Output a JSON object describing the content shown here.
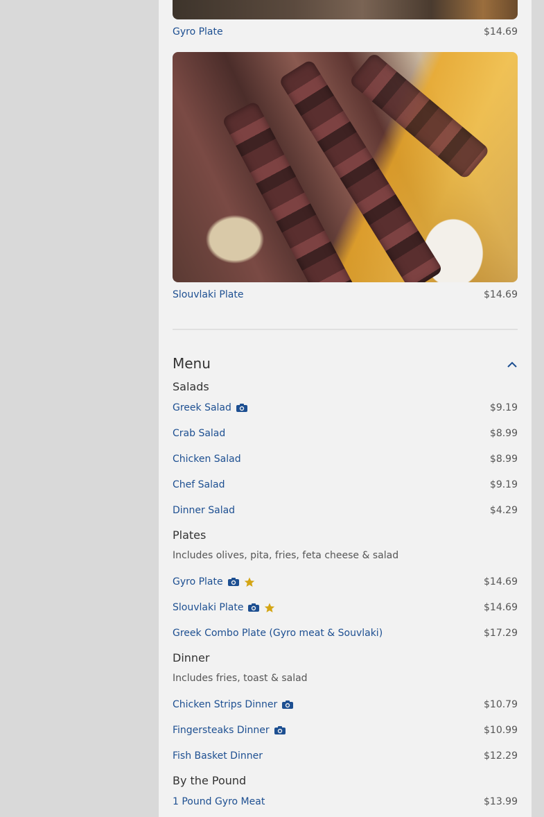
{
  "featured": [
    {
      "name": "Gyro Plate",
      "price": "$14.69"
    },
    {
      "name": "Slouvlaki Plate",
      "price": "$14.69"
    }
  ],
  "menu": {
    "title": "Menu",
    "sections": [
      {
        "title": "Salads",
        "items": [
          {
            "name": "Greek Salad",
            "price": "$9.19",
            "photo": true,
            "popular": false
          },
          {
            "name": "Crab Salad",
            "price": "$8.99"
          },
          {
            "name": "Chicken Salad",
            "price": "$8.99"
          },
          {
            "name": "Chef Salad",
            "price": "$9.19"
          },
          {
            "name": "Dinner Salad",
            "price": "$4.29"
          }
        ]
      },
      {
        "title": "Plates",
        "description": "Includes olives, pita, fries, feta cheese & salad",
        "items": [
          {
            "name": "Gyro Plate",
            "price": "$14.69",
            "photo": true,
            "popular": true
          },
          {
            "name": "Slouvlaki Plate",
            "price": "$14.69",
            "photo": true,
            "popular": true
          },
          {
            "name": "Greek Combo Plate (Gyro meat & Souvlaki)",
            "price": "$17.29"
          }
        ]
      },
      {
        "title": "Dinner",
        "description": "Includes fries, toast & salad",
        "items": [
          {
            "name": "Chicken Strips Dinner",
            "price": "$10.79",
            "photo": true
          },
          {
            "name": "Fingersteaks Dinner",
            "price": "$10.99",
            "photo": true
          },
          {
            "name": "Fish Basket Dinner",
            "price": "$12.29"
          }
        ]
      },
      {
        "title": "By the Pound",
        "items": [
          {
            "name": "1 Pound Gyro Meat",
            "price": "$13.99"
          }
        ]
      }
    ]
  },
  "icons": {
    "photo": "camera-icon",
    "popular": "star-icon",
    "collapse": "chevron-up-icon"
  },
  "colors": {
    "link": "#1d4f91",
    "star": "#d4a514",
    "panel": "#f2f2f2",
    "background": "#d9d9d9"
  }
}
